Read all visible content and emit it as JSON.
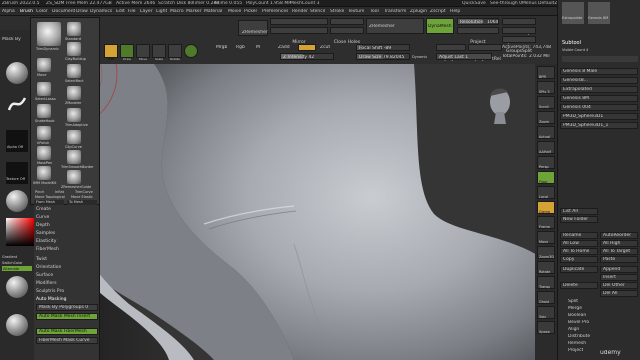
{
  "title_bar": {
    "app": "ZBrush 2022.0.5",
    "items": [
      "ZS_SDM",
      "Free Mem 22.477GB",
      "Active Mem 2646",
      "Scratch Disk 80",
      "Timer 0.248",
      "ATime 0.055",
      "PolyCount 1.958 MP",
      "MeshCount 3"
    ],
    "right": [
      "QuickSave",
      "See-through 0",
      "Menus",
      "DefaultZScript"
    ]
  },
  "menu": [
    "Alpha",
    "Brush",
    "Color",
    "Document",
    "Draw",
    "Dynamics",
    "Edit",
    "File",
    "Layer",
    "Light",
    "Macro",
    "Marker",
    "Material",
    "Movie",
    "Picker",
    "Preferences",
    "Render",
    "Stencil",
    "Stroke",
    "Texture",
    "Tool",
    "Transform",
    "Zplugin",
    "Zscript",
    "Help"
  ],
  "top_shelf": {
    "zremesher": "ZRemesher",
    "mirror_weld": "Mirror And Weld",
    "mirror": "Mirror",
    "del_hidden": "Del Hidden",
    "close_holes": "Close Holes",
    "zremesher2": "ZRemesher",
    "dynamesh": "DynaMesh",
    "resolution_label": "Resolution",
    "resolution_value": "1064",
    "project": "Project",
    "auto_groups": "Auto Groups",
    "split_hidden": "Split Hidden",
    "group_split": "GroupsSplit",
    "mrgb": "Mrgb",
    "rgb": "Rgb",
    "m": "M",
    "zadd": "Zadd",
    "zsub": "Zsub",
    "zcut": "Zcut",
    "focal_shift": "Focal Shift -89",
    "z_intensity": "Z Intensity 42",
    "draw_size": "Draw Size 79.82045",
    "dynamic": "Dynamic",
    "replay_last": "ReplayLast",
    "replay_last_rel": "ReplayLastRel",
    "adjust_last": "Adjust Last 1",
    "active_points": "ActivePoints: 743,748",
    "total_points": "TotalPoints: 2.032 Mil"
  },
  "tool_buttons": [
    "Edit",
    "Draw",
    "Move",
    "Scale",
    "Rotate"
  ],
  "brush_popup": {
    "brushes": [
      "TrimDynamic",
      "Standard",
      "ClayBuildup",
      "Move",
      "SelectRect",
      "SelectLasso",
      "ZModeler",
      "SnakeHook",
      "TrimAdaptive",
      "hPolish",
      "ClipCurve",
      "MaskPen",
      "TrimSmoothBorder",
      "IMM ModelKit",
      "ZRemesherGuide",
      "Pinch",
      "Inflat",
      "TrimCurve",
      "Move Topological",
      "Move Elastic"
    ],
    "from_mesh": "From Mesh",
    "to_mesh": "To Mesh"
  },
  "brush_list": {
    "items": [
      "Create",
      "Curve",
      "Depth",
      "Samples",
      "Elasticity",
      "FiberMesh",
      "Twist",
      "Orientation",
      "Surface",
      "Modifiers",
      "Sculptris Pro"
    ],
    "auto_masking": "Auto Masking",
    "mask_by_polygroups": "Mask By Polygroups 0",
    "auto_mask_mesh_insert": "Auto Mask Mesh Insert",
    "auto_mask_fibermesh": "Auto Mask FiberMesh",
    "fibermesh_mask_curve": "FiberMesh Mask Curve"
  },
  "left_shelf": {
    "mask_by_label": "Mask By",
    "alpha_off": "Alpha Off",
    "texture_off": "Texture Off",
    "gradient": "Gradient",
    "switch_color": "SwitchColor",
    "alternate": "Alternate"
  },
  "right_strip": [
    "BPR",
    "SPix 3",
    "Scroll",
    "Zoom",
    "Actual",
    "AAHalf",
    "Persp",
    "Floor",
    "Local",
    "Gizmo",
    "Frame",
    "Move",
    "Zoom3D",
    "Rotate",
    "Transp",
    "Ghost",
    "Solo",
    "Xpose"
  ],
  "right_tray": {
    "extrapolate_label": "Extrapolate",
    "genesis_label": "Genesis 8M",
    "subtool_header": "Subtool",
    "visible_count": "Visible Count 4",
    "subtools": [
      "Genesis 8 Male",
      "Genesis8...",
      "Extrapolated",
      "Genesis 8M",
      "Genesis 004",
      "PM3D_Sphere3D1",
      "PM3D_Sphere3D1_1"
    ],
    "buttons": [
      "List All",
      "New Folder",
      "Rename",
      "AutoReorder",
      "All Low",
      "All High",
      "All To Home",
      "All To Target",
      "Copy",
      "Paste",
      "Duplicate",
      "Append",
      "Insert",
      "Delete",
      "Del Other",
      "Del All",
      "Split",
      "Merge",
      "Boolean",
      "Bevel Pro",
      "Align",
      "Distribute",
      "Remesh",
      "Project"
    ]
  },
  "watermark": "udemy"
}
